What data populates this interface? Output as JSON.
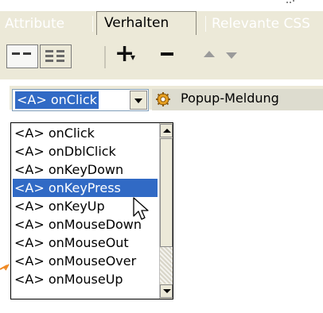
{
  "tabs": [
    {
      "label": "Attribute",
      "active": false
    },
    {
      "label": "Verhalten",
      "active": true
    },
    {
      "label": "Relevante CSS",
      "active": false
    }
  ],
  "toolbar": {
    "add_label": "+",
    "add_submenu_mark": "▾",
    "view_all_icon": "list-all-events-icon",
    "view_set_icon": "list-set-events-icon",
    "remove_icon": "minus-icon",
    "move_up_icon": "up-arrow-icon",
    "move_down_icon": "down-arrow-icon"
  },
  "event_row": {
    "selected_event": "<A> onClick",
    "action_icon": "gear-icon",
    "action": "Popup-Meldung"
  },
  "dropdown": {
    "options": [
      "<A> onClick",
      "<A> onDblClick",
      "<A> onKeyDown",
      "<A> onKeyPress",
      "<A> onKeyUp",
      "<A> onMouseDown",
      "<A> onMouseOut",
      "<A> onMouseOver",
      "<A> onMouseUp"
    ],
    "highlighted_index": 3
  },
  "colors": {
    "panel": "#ece9d8",
    "selection": "#316ac5",
    "action_cell": "#dddccf",
    "callout": "#f08a24"
  }
}
